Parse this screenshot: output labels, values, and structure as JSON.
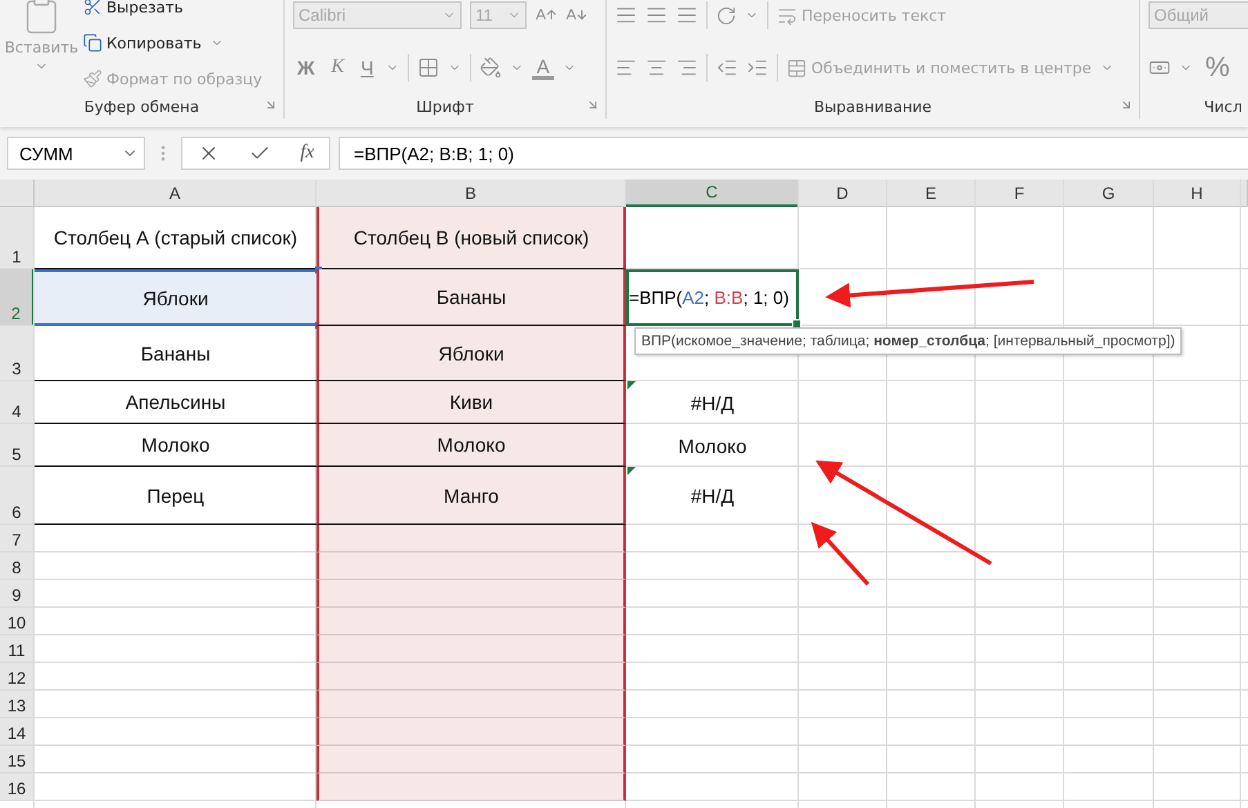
{
  "ribbon": {
    "groups": [
      {
        "kind": "clipboard",
        "label": "Буфер обмена",
        "paste": "Вставить",
        "items": [
          {
            "kind": "cut",
            "label": "Вырезать",
            "disabled": false
          },
          {
            "kind": "copy",
            "label": "Копировать",
            "disabled": false
          },
          {
            "kind": "painter",
            "label": "Формат по образцу",
            "disabled": true
          }
        ]
      },
      {
        "kind": "font",
        "label": "Шрифт",
        "font": "Calibri",
        "size": "11",
        "bold": "Ж",
        "italic": "К",
        "underline": "Ч",
        "color_letter": "А"
      },
      {
        "kind": "alignment",
        "label": "Выравнивание",
        "wrap": "Переносить текст",
        "merge": "Объединить и поместить в центре"
      },
      {
        "kind": "number",
        "label": "Числ",
        "format": "Общий",
        "percent": "%"
      }
    ]
  },
  "formula_bar": {
    "name_box": "СУММ",
    "fx": "fx",
    "formula": "=ВПР(A2; B:B; 1; 0)"
  },
  "sheet": {
    "columns": [
      {
        "label": "A",
        "selected": false,
        "marked": false
      },
      {
        "label": "B",
        "selected": false,
        "marked": true
      },
      {
        "label": "C",
        "selected": true,
        "marked": false
      },
      {
        "label": "D",
        "selected": false,
        "marked": false
      },
      {
        "label": "E",
        "selected": false,
        "marked": false
      },
      {
        "label": "F",
        "selected": false,
        "marked": false
      },
      {
        "label": "G",
        "selected": false,
        "marked": false
      },
      {
        "label": "H",
        "selected": false,
        "marked": false
      }
    ],
    "rows": [
      {
        "number": "1",
        "selected": false,
        "cells": [
          {
            "kind": "plain",
            "text": "Столбец А (старый список)"
          },
          {
            "kind": "plain",
            "text": "Столбец B (новый список)"
          }
        ]
      },
      {
        "number": "2",
        "selected": true,
        "cells": [
          {
            "kind": "reference",
            "text": "Яблоки"
          },
          {
            "kind": "plain",
            "text": "Бананы"
          },
          {
            "kind": "editing",
            "parts": [
              {
                "text": "=ВПР(",
                "color": "#000000"
              },
              {
                "text": "A2",
                "color": "#3b72c9"
              },
              {
                "text": "; ",
                "color": "#000000"
              },
              {
                "text": "B:B",
                "color": "#d2434d"
              },
              {
                "text": "; 1; 0)",
                "color": "#000000"
              }
            ]
          }
        ]
      },
      {
        "number": "3",
        "selected": false,
        "cells": [
          {
            "kind": "plain",
            "text": "Бананы"
          },
          {
            "kind": "plain",
            "text": "Яблоки"
          }
        ]
      },
      {
        "number": "4",
        "selected": false,
        "cells": [
          {
            "kind": "plain",
            "text": "Апельсины"
          },
          {
            "kind": "plain",
            "text": "Киви"
          },
          {
            "kind": "error",
            "text": "#Н/Д"
          }
        ]
      },
      {
        "number": "5",
        "selected": false,
        "cells": [
          {
            "kind": "plain",
            "text": "Молоко"
          },
          {
            "kind": "plain",
            "text": "Молоко"
          },
          {
            "kind": "plain",
            "text": "Молоко"
          }
        ]
      },
      {
        "number": "6",
        "selected": false,
        "cells": [
          {
            "kind": "plain",
            "text": "Перец"
          },
          {
            "kind": "plain",
            "text": "Манго"
          },
          {
            "kind": "error",
            "text": "#Н/Д"
          }
        ]
      },
      {
        "number": "7",
        "selected": false,
        "cells": []
      },
      {
        "number": "8",
        "selected": false,
        "cells": []
      },
      {
        "number": "9",
        "selected": false,
        "cells": []
      },
      {
        "number": "10",
        "selected": false,
        "cells": []
      },
      {
        "number": "11",
        "selected": false,
        "cells": []
      },
      {
        "number": "12",
        "selected": false,
        "cells": []
      },
      {
        "number": "13",
        "selected": false,
        "cells": []
      },
      {
        "number": "14",
        "selected": false,
        "cells": []
      },
      {
        "number": "15",
        "selected": false,
        "cells": []
      },
      {
        "number": "16",
        "selected": false,
        "cells": []
      }
    ]
  },
  "tooltip": "ВПР(искомое_значение; таблица; **номер_столбца**; [интервальный_просмотр])"
}
